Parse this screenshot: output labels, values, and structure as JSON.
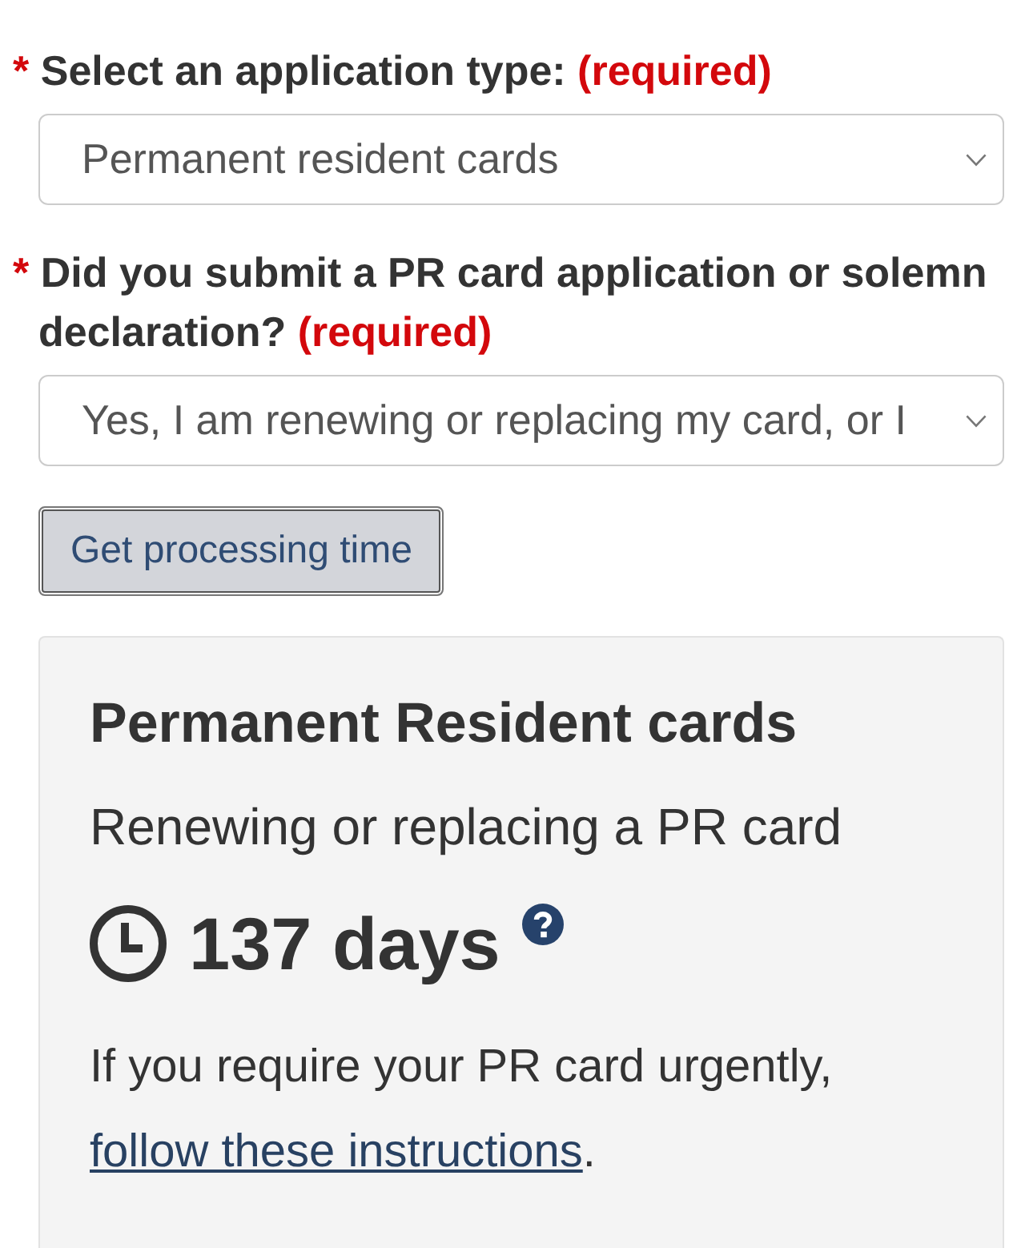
{
  "form": {
    "fields": [
      {
        "required_mark": "*",
        "label": "Select an application type:",
        "required_note": "(required)",
        "value": "Permanent resident cards"
      },
      {
        "required_mark": "*",
        "label": "Did you submit a PR card application or solemn declaration?",
        "required_note": "(required)",
        "value": "Yes, I am renewing or replacing my card, or I"
      }
    ]
  },
  "button": {
    "label": "Get processing time"
  },
  "result": {
    "title": "Permanent Resident cards",
    "subtitle": "Renewing or replacing a PR card",
    "time": "137 days",
    "note": "If you require your PR card urgently,",
    "link": "follow these instructions",
    "note_end": "."
  }
}
